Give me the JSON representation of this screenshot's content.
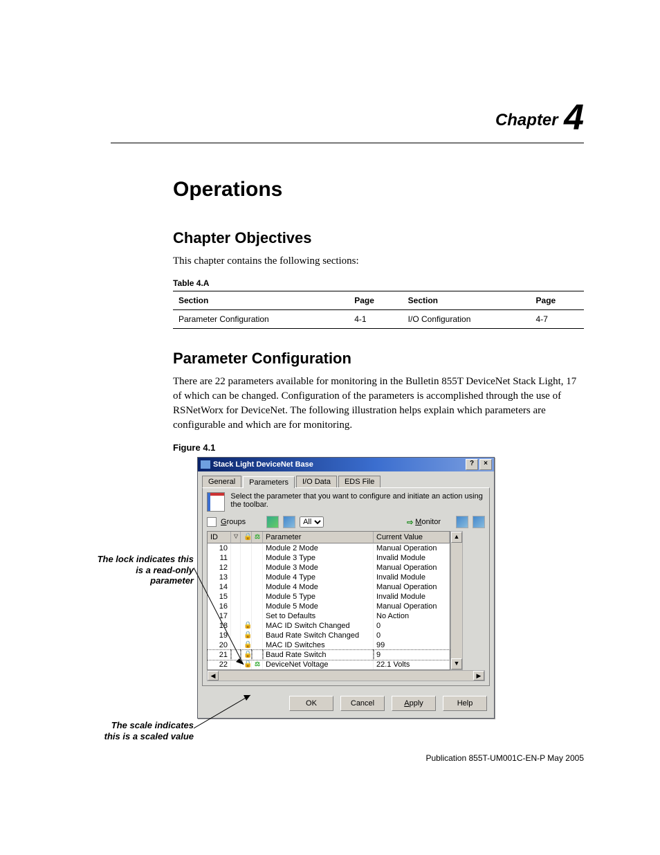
{
  "chapter": {
    "word": "Chapter",
    "number": "4"
  },
  "title": "Operations",
  "objectives": {
    "heading": "Chapter Objectives",
    "intro": "This chapter contains the following sections:"
  },
  "table4a": {
    "caption": "Table 4.A",
    "headers": {
      "section": "Section",
      "page": "Page"
    },
    "rows": [
      {
        "section": "Parameter Configuration",
        "page": "4-1"
      },
      {
        "section": "I/O Configuration",
        "page": "4-7"
      }
    ]
  },
  "paramConfig": {
    "heading": "Parameter Configuration",
    "body": "There are 22 parameters available for monitoring in the Bulletin 855T DeviceNet Stack Light, 17 of which can be changed. Configuration of the parameters is accomplished through the use of RSNetWorx for DeviceNet. The following illustration helps explain which parameters are configurable and which are for monitoring."
  },
  "figure": {
    "caption": "Figure 4.1",
    "annotations": {
      "lock": "The lock indicates this is a read-only parameter",
      "scale": "The scale indicates this is a scaled value"
    },
    "dialog": {
      "title": "Stack Light DeviceNet Base",
      "titlebarButtons": {
        "help": "?",
        "close": "×"
      },
      "tabs": [
        "General",
        "Parameters",
        "I/O Data",
        "EDS File"
      ],
      "activeTab": 1,
      "instruction": "Select the parameter that you want to configure and initiate an action using the toolbar.",
      "groupsLabel": "Groups",
      "groupsUnderlineChar": "G",
      "filterValue": "All",
      "monitorLabel": "Monitor",
      "monitorUnderlineChar": "M",
      "columns": {
        "id": "ID",
        "parameter": "Parameter",
        "value": "Current Value"
      },
      "rows": [
        {
          "id": "10",
          "lock": false,
          "scale": false,
          "param": "Module 2 Mode",
          "value": "Manual Operation"
        },
        {
          "id": "11",
          "lock": false,
          "scale": false,
          "param": "Module 3 Type",
          "value": "Invalid Module"
        },
        {
          "id": "12",
          "lock": false,
          "scale": false,
          "param": "Module 3 Mode",
          "value": "Manual Operation"
        },
        {
          "id": "13",
          "lock": false,
          "scale": false,
          "param": "Module 4 Type",
          "value": "Invalid Module"
        },
        {
          "id": "14",
          "lock": false,
          "scale": false,
          "param": "Module 4 Mode",
          "value": "Manual Operation"
        },
        {
          "id": "15",
          "lock": false,
          "scale": false,
          "param": "Module 5 Type",
          "value": "Invalid Module"
        },
        {
          "id": "16",
          "lock": false,
          "scale": false,
          "param": "Module 5 Mode",
          "value": "Manual Operation"
        },
        {
          "id": "17",
          "lock": false,
          "scale": false,
          "param": "Set to Defaults",
          "value": "No Action"
        },
        {
          "id": "18",
          "lock": true,
          "scale": false,
          "param": "MAC ID Switch Changed",
          "value": "0"
        },
        {
          "id": "19",
          "lock": true,
          "scale": false,
          "param": "Baud Rate Switch Changed",
          "value": "0"
        },
        {
          "id": "20",
          "lock": true,
          "scale": false,
          "param": "MAC ID Switches",
          "value": "99"
        },
        {
          "id": "21",
          "lock": true,
          "scale": false,
          "param": "Baud Rate Switch",
          "value": "9",
          "selected": true
        },
        {
          "id": "22",
          "lock": true,
          "scale": true,
          "param": "DeviceNet Voltage",
          "value": "22.1 Volts"
        }
      ],
      "buttons": {
        "ok": "OK",
        "cancel": "Cancel",
        "apply": "Apply",
        "help": "Help"
      },
      "applyUnderlineChar": "A"
    }
  },
  "publication": "Publication 855T-UM001C-EN-P   May 2005"
}
